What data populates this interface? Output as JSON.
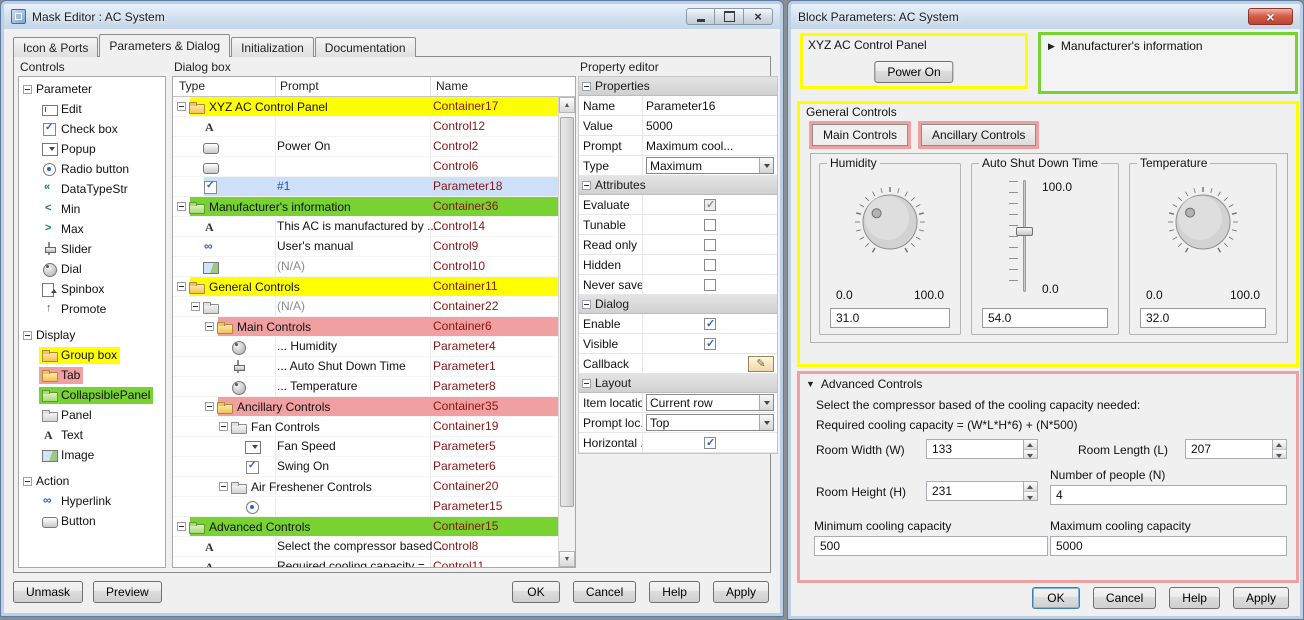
{
  "colors": {
    "highlight_yellow": "#ffff00",
    "highlight_green": "#77d232",
    "highlight_pink": "#f0a0a0",
    "selected_row": "#cde0f7",
    "name_text": "#8b1515"
  },
  "mask_editor": {
    "title": "Mask Editor : AC System",
    "tabs": [
      "Icon & Ports",
      "Parameters & Dialog",
      "Initialization",
      "Documentation"
    ],
    "active_tab": "Parameters & Dialog",
    "controls_panel": {
      "title": "Controls",
      "groups": [
        {
          "label": "Parameter",
          "items": [
            {
              "label": "Edit",
              "icon": "edit"
            },
            {
              "label": "Check box",
              "icon": "checkbox"
            },
            {
              "label": "Popup",
              "icon": "popup"
            },
            {
              "label": "Radio button",
              "icon": "radio"
            },
            {
              "label": "DataTypeStr",
              "icon": "datatype"
            },
            {
              "label": "Min",
              "icon": "min"
            },
            {
              "label": "Max",
              "icon": "max"
            },
            {
              "label": "Slider",
              "icon": "slider"
            },
            {
              "label": "Dial",
              "icon": "dial"
            },
            {
              "label": "Spinbox",
              "icon": "spinbox"
            },
            {
              "label": "Promote",
              "icon": "promote"
            }
          ]
        },
        {
          "label": "Display",
          "items": [
            {
              "label": "Group box",
              "icon": "groupbox",
              "highlight": "yellow"
            },
            {
              "label": "Tab",
              "icon": "tab",
              "highlight": "pink"
            },
            {
              "label": "CollapsiblePanel",
              "icon": "collapsible",
              "highlight": "green"
            },
            {
              "label": "Panel",
              "icon": "panel"
            },
            {
              "label": "Text",
              "icon": "text"
            },
            {
              "label": "Image",
              "icon": "image"
            }
          ]
        },
        {
          "label": "Action",
          "items": [
            {
              "label": "Hyperlink",
              "icon": "hyperlink"
            },
            {
              "label": "Button",
              "icon": "button"
            }
          ]
        }
      ]
    },
    "dialog_box": {
      "title": "Dialog box",
      "columns": [
        "Type",
        "Prompt",
        "Name"
      ],
      "rows": [
        {
          "indent": 0,
          "expander": true,
          "icon": "groupbox",
          "prompt": "XYZ AC Control Panel",
          "name": "Container17",
          "highlight": "yellow"
        },
        {
          "indent": 1,
          "expander": false,
          "icon": "text",
          "prompt": "",
          "name": "Control12"
        },
        {
          "indent": 1,
          "expander": false,
          "icon": "button",
          "prompt": "Power On",
          "name": "Control2"
        },
        {
          "indent": 1,
          "expander": false,
          "icon": "button",
          "prompt": "",
          "name": "Control6"
        },
        {
          "indent": 1,
          "expander": false,
          "icon": "checkbox",
          "prompt": "#1",
          "name": "Parameter18",
          "highlight": "selected",
          "prompt_color": "#2348c7"
        },
        {
          "indent": 0,
          "expander": true,
          "icon": "collapsible",
          "prompt": "Manufacturer's information",
          "name": "Container36",
          "highlight": "green"
        },
        {
          "indent": 1,
          "expander": false,
          "icon": "text",
          "prompt": "This AC is manufactured by ...",
          "name": "Control14"
        },
        {
          "indent": 1,
          "expander": false,
          "icon": "hyperlink",
          "prompt": "User's manual",
          "name": "Control9"
        },
        {
          "indent": 1,
          "expander": false,
          "icon": "image",
          "prompt": "(N/A)",
          "name": "Control10"
        },
        {
          "indent": 0,
          "expander": true,
          "icon": "groupbox",
          "prompt": "General Controls",
          "name": "Container11",
          "highlight": "yellow"
        },
        {
          "indent": 1,
          "expander": true,
          "icon": "panel",
          "prompt": "(N/A)",
          "name": "Container22"
        },
        {
          "indent": 2,
          "expander": true,
          "icon": "tab",
          "prompt": "Main Controls",
          "name": "Container6",
          "highlight": "pink"
        },
        {
          "indent": 3,
          "expander": false,
          "icon": "dial",
          "prompt": "... Humidity",
          "name": "Parameter4"
        },
        {
          "indent": 3,
          "expander": false,
          "icon": "slider",
          "prompt": "... Auto Shut Down Time",
          "name": "Parameter1"
        },
        {
          "indent": 3,
          "expander": false,
          "icon": "dial",
          "prompt": "... Temperature",
          "name": "Parameter8"
        },
        {
          "indent": 2,
          "expander": true,
          "icon": "tab",
          "prompt": "Ancillary Controls",
          "name": "Container35",
          "highlight": "pink"
        },
        {
          "indent": 3,
          "expander": true,
          "icon": "panel",
          "prompt": "Fan Controls",
          "name": "Container19"
        },
        {
          "indent": 4,
          "expander": false,
          "icon": "popup",
          "prompt": "Fan Speed",
          "name": "Parameter5"
        },
        {
          "indent": 4,
          "expander": false,
          "icon": "checkbox",
          "prompt": "Swing On",
          "name": "Parameter6"
        },
        {
          "indent": 3,
          "expander": true,
          "icon": "panel",
          "prompt": "Air Freshener Controls",
          "name": "Container20"
        },
        {
          "indent": 4,
          "expander": false,
          "icon": "radio",
          "prompt": "",
          "name": "Parameter15"
        },
        {
          "indent": 0,
          "expander": true,
          "icon": "collapsible",
          "prompt": "Advanced Controls",
          "name": "Container15",
          "highlight": "green"
        },
        {
          "indent": 1,
          "expander": false,
          "icon": "text",
          "prompt": "Select the compressor based ...",
          "name": "Control8"
        },
        {
          "indent": 1,
          "expander": false,
          "icon": "text",
          "prompt": "Required cooling capacity = ...",
          "name": "Control11"
        }
      ]
    },
    "property_editor": {
      "title": "Property editor",
      "sections": [
        {
          "title": "Properties",
          "rows": [
            {
              "label": "Name",
              "kind": "text",
              "value": "Parameter16"
            },
            {
              "label": "Value",
              "kind": "text",
              "value": "5000"
            },
            {
              "label": "Prompt",
              "kind": "text",
              "value": "Maximum cool..."
            },
            {
              "label": "Type",
              "kind": "dropdown",
              "value": "Maximum"
            }
          ]
        },
        {
          "title": "Attributes",
          "rows": [
            {
              "label": "Evaluate",
              "kind": "checkbox",
              "checked": true,
              "disabled": true
            },
            {
              "label": "Tunable",
              "kind": "checkbox",
              "checked": false
            },
            {
              "label": "Read only",
              "kind": "checkbox",
              "checked": false
            },
            {
              "label": "Hidden",
              "kind": "checkbox",
              "checked": false
            },
            {
              "label": "Never save",
              "kind": "checkbox",
              "checked": false
            }
          ]
        },
        {
          "title": "Dialog",
          "rows": [
            {
              "label": "Enable",
              "kind": "checkbox",
              "checked": true
            },
            {
              "label": "Visible",
              "kind": "checkbox",
              "checked": true
            },
            {
              "label": "Callback",
              "kind": "edit-button"
            }
          ]
        },
        {
          "title": "Layout",
          "rows": [
            {
              "label": "Item location",
              "kind": "dropdown",
              "value": "Current row"
            },
            {
              "label": "Prompt loc...",
              "kind": "dropdown",
              "value": "Top"
            },
            {
              "label": "Horizontal ...",
              "kind": "checkbox",
              "checked": true
            }
          ]
        }
      ]
    },
    "footer_buttons_left": [
      "Unmask",
      "Preview"
    ],
    "footer_buttons_right": [
      "OK",
      "Cancel",
      "Help",
      "Apply"
    ]
  },
  "block_dialog": {
    "title": "Block Parameters: AC System",
    "xyz_panel": {
      "title": "XYZ AC Control Panel",
      "button": "Power On"
    },
    "manufacturer_panel": {
      "arrow": "▶",
      "title": "Manufacturer's information"
    },
    "general_controls": {
      "title": "General Controls",
      "tabs": [
        "Main Controls",
        "Ancillary Controls"
      ],
      "active_tab": "Main Controls",
      "humidity": {
        "label": "Humidity",
        "min": "0.0",
        "max": "100.0",
        "value": "31.0"
      },
      "auto_shut_down": {
        "label": "Auto Shut Down Time",
        "min": "0.0",
        "max": "100.0",
        "value": "54.0"
      },
      "temperature": {
        "label": "Temperature",
        "min": "0.0",
        "max": "100.0",
        "value": "32.0"
      }
    },
    "advanced_controls": {
      "arrow": "▼",
      "title": "Advanced Controls",
      "line1": "Select the compressor based of the cooling capacity needed:",
      "line2": "Required cooling capacity = (W*L*H*6) + (N*500)",
      "fields": {
        "room_width": {
          "label": "Room Width (W)",
          "value": "133"
        },
        "room_length": {
          "label": "Room Length (L)",
          "value": "207"
        },
        "room_height": {
          "label": "Room Height (H)",
          "value": "231"
        },
        "people": {
          "label": "Number of people (N)",
          "value": "4"
        },
        "min_cooling": {
          "label": "Minimum cooling capacity",
          "value": "500"
        },
        "max_cooling": {
          "label": "Maximum cooling capacity",
          "value": "5000"
        }
      }
    },
    "footer_buttons": [
      "OK",
      "Cancel",
      "Help",
      "Apply"
    ],
    "default_button": "OK"
  }
}
